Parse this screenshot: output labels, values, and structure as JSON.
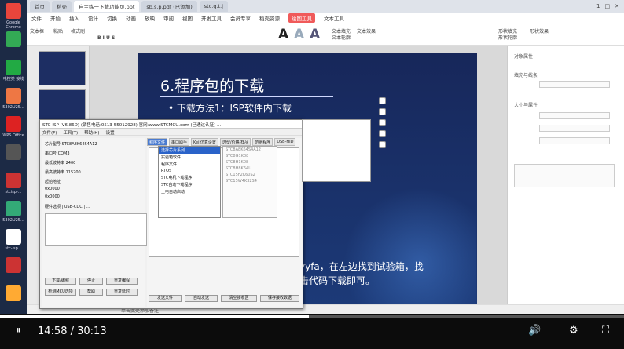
{
  "desktop": {
    "dock": [
      {
        "label": "Google Chrome",
        "color": "#e8453c"
      },
      {
        "label": "",
        "color": "#3a5"
      },
      {
        "label": "电控类 接线",
        "color": "#2a4"
      },
      {
        "label": "5302U25...",
        "color": "#e74"
      },
      {
        "label": "WPS Office",
        "color": "#d22"
      },
      {
        "label": "",
        "color": "#555"
      },
      {
        "label": "stcisp-...",
        "color": "#c33"
      },
      {
        "label": "5302U25...",
        "color": "#3a7"
      },
      {
        "label": "stc-isp...",
        "color": "#fff"
      },
      {
        "label": "",
        "color": "#c33"
      },
      {
        "label": "",
        "color": "#fa3"
      },
      {
        "label": "电竞竞",
        "color": "#3a5"
      }
    ]
  },
  "wps": {
    "tabs": [
      "首页",
      "稻壳",
      "自主练一下载功能页.ppt",
      "sb.s.p.pdf (已添加)",
      "stc.g.t.j"
    ],
    "right": [
      "1",
      "□",
      "✕"
    ],
    "menu": [
      "文件",
      "开始",
      "插入",
      "设计",
      "切换",
      "动画",
      "放映",
      "审阅",
      "视图",
      "开发工具",
      "会员专享",
      "稻壳资源",
      "绘图工具",
      "文本工具"
    ],
    "menu_highlight": "绘图工具",
    "ribbon": [
      "文本框",
      "粘贴",
      "格式刷",
      "B I U S",
      "A",
      "A",
      "A",
      "文本填充",
      "文本轮廓",
      "文本效果",
      "形状填充",
      "形状轮廓",
      "形状效果"
    ],
    "status": "单击此处添加备注"
  },
  "slide": {
    "title": "6.程序包的下载",
    "subtitle": "• 下载方法1：ISP软件内下载",
    "footer_line1": "yyfa，在左边找到试验箱，找",
    "footer_line2": "击代码下载即可。"
  },
  "stc": {
    "title": "STC-ISP (V6.86D) (销售电话:0513-55012928) 官网:www.STCMCU.com (已通过认证) ...",
    "menu": [
      "文件(F)",
      "工具(T)",
      "帮助(H)",
      "设置"
    ],
    "rows": [
      "芯片型号 STC8A8K64S4A12",
      "串口号 COM3",
      "最低波特率 2400",
      "最高波特率 115200",
      "起始地址",
      "0x0000",
      "0x0000",
      "硬件选项 | USB-CDC | ..."
    ],
    "tabs": [
      "程序文件",
      "串口助手",
      "Keil仿真设置",
      "选型/价格/样品",
      "范例程序",
      "USB-HID"
    ],
    "popup": [
      "选择芯片系列",
      "实验箱软件",
      "程序文件",
      "RTOS",
      "STC电机下载程序",
      "STC自动下载程序",
      "上电自动启动"
    ],
    "popup2": [
      "STC8A8K64S4A12",
      "STC8G1K08",
      "STC8H1K08",
      "STC8H8K64U",
      "STC15F2K60S2",
      "STC15W4K32S4"
    ],
    "buttons": [
      "下载/编程",
      "停止",
      "重复编程",
      "检测MCU选项",
      "帮助",
      "重复延时"
    ],
    "bottom": [
      "发送文件",
      "自动发送",
      "清空接收区",
      "保存接收数据"
    ]
  },
  "player": {
    "current": "14:58",
    "total": "30:13",
    "progress": 0.495,
    "controls": [
      "⏸",
      "🔊",
      "⚙",
      "⛶"
    ]
  }
}
